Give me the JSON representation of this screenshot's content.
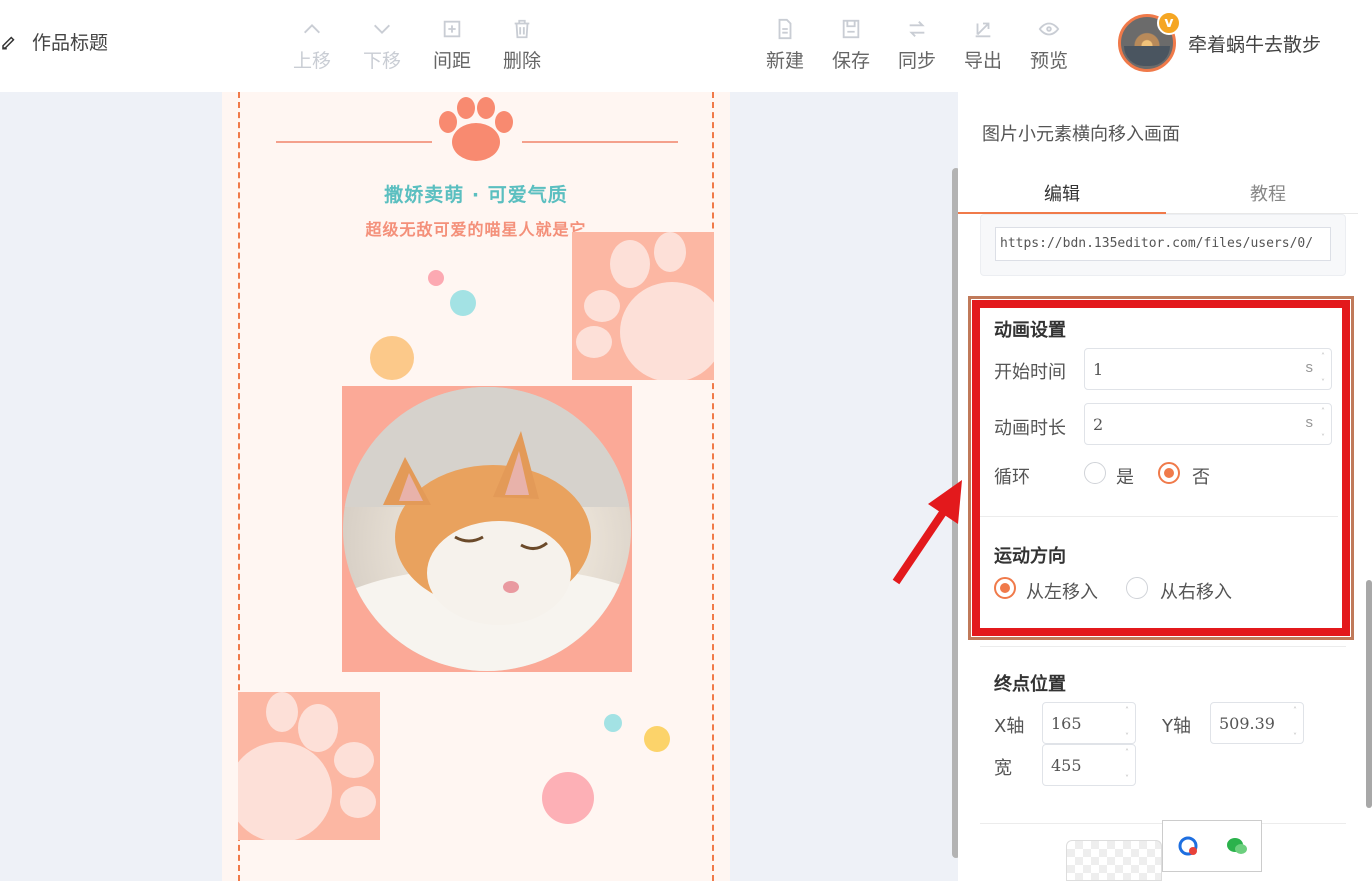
{
  "toolbar": {
    "title_label": "作品标题",
    "move_up": "上移",
    "move_down": "下移",
    "spacing": "间距",
    "delete": "删除",
    "new": "新建",
    "save": "保存",
    "sync": "同步",
    "export": "导出",
    "preview": "预览"
  },
  "user": {
    "name": "牵着蜗牛去散步",
    "badge": "v"
  },
  "canvas": {
    "headline": "撒娇卖萌 · 可爱气质",
    "subline": "超级无敌可爱的喵星人就是它"
  },
  "panel": {
    "title": "图片小元素横向移入画面",
    "tabs": [
      "编辑",
      "教程"
    ],
    "image_url": "https://bdn.135editor.com/files/users/0/",
    "animation": {
      "heading": "动画设置",
      "start_label": "开始时间",
      "start_value": "1",
      "duration_label": "动画时长",
      "duration_value": "2",
      "unit": "s",
      "loop_label": "循环",
      "loop_yes": "是",
      "loop_no": "否",
      "loop_selected": "否"
    },
    "direction": {
      "heading": "运动方向",
      "from_left": "从左移入",
      "from_right": "从右移入",
      "selected": "从左移入"
    },
    "end_position": {
      "heading": "终点位置",
      "x_label": "X轴",
      "x_value": "165",
      "y_label": "Y轴",
      "y_value": "509.39",
      "width_label": "宽",
      "width_value": "455"
    }
  },
  "colors": {
    "accent": "#f07a4a",
    "highlight": "#e3191c",
    "teal": "#5bbfc0",
    "salmon": "#fba997"
  }
}
